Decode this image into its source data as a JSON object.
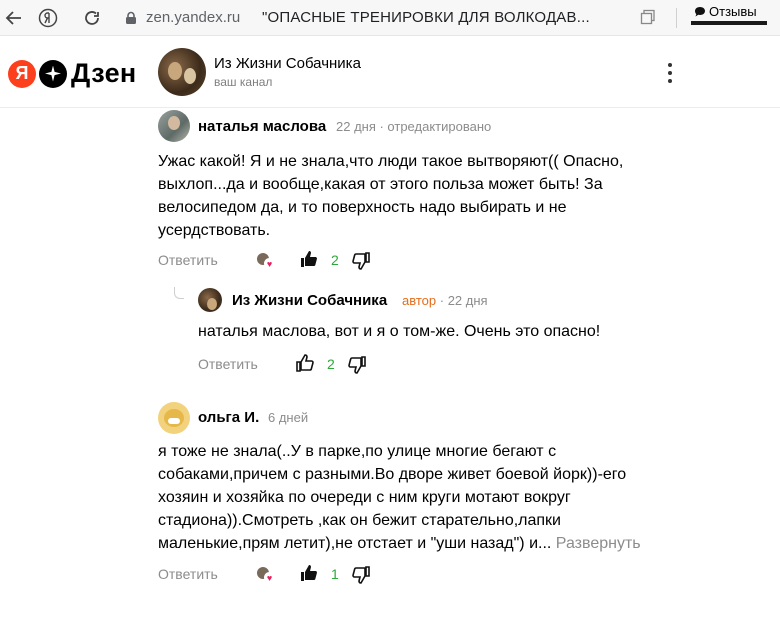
{
  "browser": {
    "domain": "zen.yandex.ru",
    "title": "\"ОПАСНЫЕ ТРЕНИРОВКИ ДЛЯ ВОЛКОДАВ...",
    "reviews_label": "Отзывы"
  },
  "header": {
    "logo_text": "Дзен",
    "channel_name": "Из Жизни Собачника",
    "channel_subtitle": "ваш канал"
  },
  "comments": [
    {
      "author": "наталья маслова",
      "meta": "22 дня · отредактировано",
      "lines": [
        "Ужас какой! Я и не знала,что люди такое вытворяют(( Опасно,",
        "выхлоп...да и вообще,какая от этого польза может быть! За",
        "велосипедом да, и то поверхность надо выбирать и не",
        "усердствовать."
      ],
      "reply_label": "Ответить",
      "likes": "2"
    },
    {
      "author": "Из Жизни Собачника",
      "author_tag": "автор",
      "meta": "· 22 дня",
      "text": "наталья маслова, вот и я о том-же. Очень это опасно!",
      "reply_label": "Ответить",
      "likes": "2"
    },
    {
      "author": "ольга И.",
      "meta": "6 дней",
      "lines": [
        "я тоже не знала(..У в парке,по улице многие бегают с",
        "собаками,причем с разными.Во дворе живет боевой йорк))-его",
        "хозяин и хозяйка по очереди с ним круги мотают вокруг",
        "стадиона)).Смотреть ,как он бежит старательно,лапки",
        "маленькие,прям летит),не отстает и \"уши назад\") и..."
      ],
      "expand_label": "Развернуть",
      "reply_label": "Ответить",
      "likes": "1"
    }
  ]
}
